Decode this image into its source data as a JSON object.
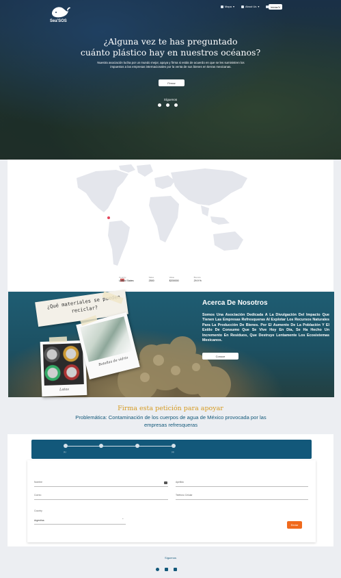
{
  "brand": {
    "name": "Sea'SOS"
  },
  "nav": {
    "items": [
      {
        "label": "Mapa"
      },
      {
        "label": "About Us"
      },
      {
        "label": "Firmar"
      }
    ],
    "button_label": "Iniciar/V"
  },
  "hero": {
    "title_line1": "¿Alguna vez te has preguntado",
    "title_line2": "cuánto plástico hay en nuestros océanos?",
    "subtitle": "Nuestra asociación lucha por un mundo mejor, apoya y firma si estás de acuerdo en que se les suministren los impuestos a las empresas internacionales por la venta de sus bienes en tierras mexicanas.",
    "cta_label": "Firmar",
    "follow_label": "Síguenos",
    "social": [
      "facebook-icon",
      "instagram-icon",
      "twitter-icon"
    ]
  },
  "map": {
    "marker_color": "#e4465c",
    "stats": [
      {
        "label": "Country",
        "value": "United States"
      },
      {
        "label": "Sales",
        "value": "2500"
      },
      {
        "label": "Value",
        "value": "$200000"
      },
      {
        "label": "Bounce",
        "value": "29.9 %"
      }
    ]
  },
  "about": {
    "title": "Acerca De Nosotros",
    "body": "Somos Una Asociación Dedicada A La Divulgación Del Impacto Que Tienen Las Empresas Refresqueras Al Explotar Los Recursos Naturales Para La Producción De Bienes. Por El Aumento De La Población Y El Estilo De Consumo Que Se Vive Hoy En Día, Se Ha Hecho Un Incremento En Residuos, Que Destruye Lentamente Los Ecosistemas Mexicanos.",
    "button_label": "Conoce",
    "note": "¿Qué materiales se pueden reciclar?",
    "caption_cans": "Latas",
    "caption_bottles": "Botellas de vidrio"
  },
  "petition": {
    "title": "Firma esta petición para apoyar",
    "subtitle": "Problemática: Contaminación de los cuerpos de agua de México provocada por las empresas refresqueras",
    "steps": [
      "(1)",
      "",
      "",
      "(4)"
    ],
    "fields": {
      "nombre": "Nombre",
      "apellido": "Apellido",
      "correo": "Correo",
      "telefono": "Teléfono Celular",
      "country_label": "Country",
      "country_value": "Argentina"
    },
    "send_label": "Enviar"
  },
  "footer": {
    "follow_label": "Síguenos",
    "icons": [
      "facebook-icon",
      "instagram-icon",
      "linkedin-icon"
    ]
  },
  "colors": {
    "primary": "#12587a",
    "accent": "#f06a1d",
    "title_gold": "#d59a21"
  }
}
